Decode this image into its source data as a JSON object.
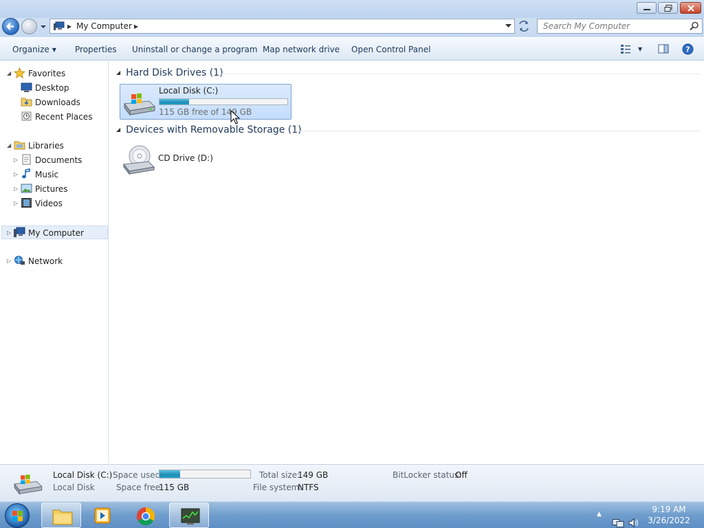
{
  "window": {
    "address_crumb": "My Computer",
    "search_placeholder": "Search My Computer"
  },
  "toolbar": {
    "organize": "Organize",
    "properties": "Properties",
    "uninstall": "Uninstall or change a program",
    "map_drive": "Map network drive",
    "control_panel": "Open Control Panel"
  },
  "nav": {
    "favorites": "Favorites",
    "desktop": "Desktop",
    "downloads": "Downloads",
    "recent_places": "Recent Places",
    "libraries": "Libraries",
    "documents": "Documents",
    "music": "Music",
    "pictures": "Pictures",
    "videos": "Videos",
    "my_computer": "My Computer",
    "network": "Network"
  },
  "content": {
    "hard_disk_group": "Hard Disk Drives (1)",
    "removable_group": "Devices with Removable Storage (1)",
    "local_disk": {
      "name": "Local Disk (C:)",
      "free_text": "115 GB free of 149 GB",
      "used_fraction": 0.23
    },
    "cd_drive": {
      "name": "CD Drive (D:)"
    }
  },
  "details": {
    "name": "Local Disk (C:)",
    "type": "Local Disk",
    "space_used_label": "Space used:",
    "space_free_label": "Space free:",
    "space_free_value": "115 GB",
    "total_size_label": "Total size:",
    "total_size_value": "149 GB",
    "file_system_label": "File system:",
    "file_system_value": "NTFS",
    "bitlocker_label": "BitLocker status:",
    "bitlocker_value": "Off"
  },
  "taskbar": {
    "time": "9:19 AM",
    "date": "3/26/2022"
  },
  "colors": {
    "group_heading": "#1e395b",
    "selection": "#cfe3fc",
    "bar_fill": "#1e8db4"
  }
}
